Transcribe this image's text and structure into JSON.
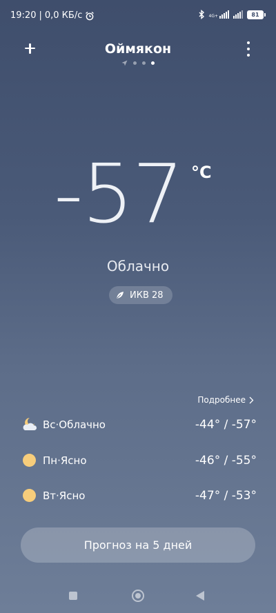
{
  "status": {
    "time": "19:20",
    "speed": "0,0 КБ/с",
    "network": "4G+",
    "battery": "81"
  },
  "header": {
    "city": "Оймякон",
    "page_count": 4,
    "active_page": 4
  },
  "current": {
    "temperature": "-57",
    "unit": "°C",
    "condition": "Облачно",
    "aqi_label": "ИКВ 28"
  },
  "forecast": {
    "more_label": "Подробнее",
    "days": [
      {
        "label": "Вс·Облачно",
        "temps": "-44° / -57°",
        "icon": "moon-cloud-icon"
      },
      {
        "label": "Пн·Ясно",
        "temps": "-46° / -55°",
        "icon": "sun-icon"
      },
      {
        "label": "Вт·Ясно",
        "temps": "-47° / -53°",
        "icon": "sun-icon"
      }
    ],
    "five_day_button": "Прогноз на 5 дней"
  },
  "colors": {
    "background_top": "#3f4e6c",
    "background_bottom": "#6e7e98",
    "sun": "#f7cd7b"
  }
}
